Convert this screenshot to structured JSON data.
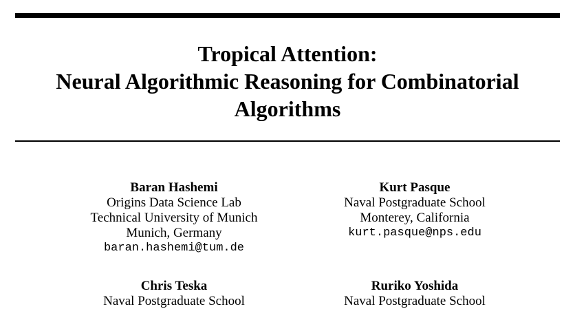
{
  "paper": {
    "title_lines": [
      "Tropical Attention:",
      "Neural Algorithmic Reasoning for Combinatorial",
      "Algorithms"
    ],
    "authors": [
      {
        "name": "Baran Hashemi",
        "affiliation_lines": [
          "Origins Data Science Lab",
          "Technical University of Munich",
          "Munich, Germany"
        ],
        "email": "baran.hashemi@tum.de"
      },
      {
        "name": "Kurt Pasque",
        "affiliation_lines": [
          "Naval Postgraduate School",
          "Monterey, California"
        ],
        "email": "kurt.pasque@nps.edu"
      },
      {
        "name": "Chris Teska",
        "affiliation_lines": [
          "Naval Postgraduate School"
        ]
      },
      {
        "name": "Ruriko Yoshida",
        "affiliation_lines": [
          "Naval Postgraduate School"
        ]
      }
    ]
  }
}
